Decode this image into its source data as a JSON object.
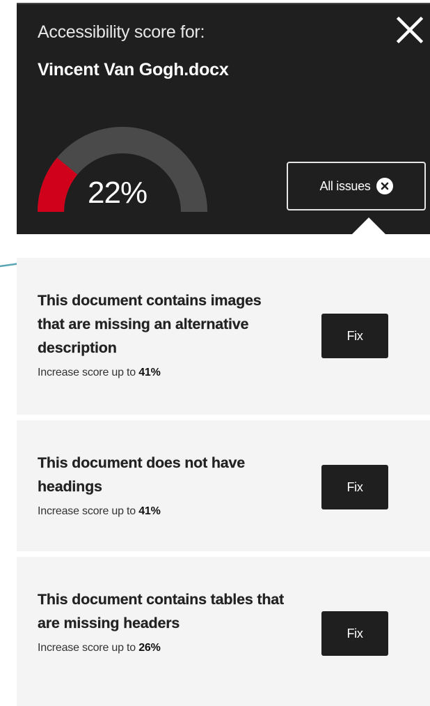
{
  "header": {
    "label": "Accessibility score for:",
    "filename": "Vincent Van Gogh.docx",
    "score_text": "22%",
    "score_value": 22,
    "all_issues_label": "All issues"
  },
  "colors": {
    "header_bg": "#1f1f1f",
    "gauge_track": "#4a4a4a",
    "gauge_fill": "#d0021b",
    "panel_bg": "#f4f4f4",
    "doodle": "#5aa6b5"
  },
  "icons": {
    "close": "close-icon",
    "clear": "x-circle-icon",
    "doodle": "arrow-doodle-icon"
  },
  "issues": [
    {
      "title": "This document contains images that are missing an alternative description",
      "sub_prefix": "Increase score up to",
      "sub_value": "41%",
      "fix_label": "Fix"
    },
    {
      "title": "This document does not have headings",
      "sub_prefix": "Increase score up to",
      "sub_value": "41%",
      "fix_label": "Fix"
    },
    {
      "title": "This document contains tables that are missing headers",
      "sub_prefix": "Increase score up to",
      "sub_value": "26%",
      "fix_label": "Fix"
    }
  ]
}
